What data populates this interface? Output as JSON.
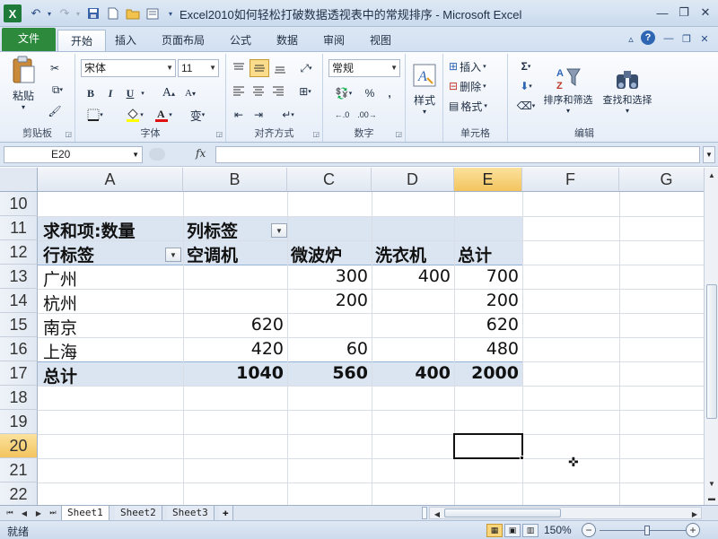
{
  "window": {
    "title": "Excel2010如何轻松打破数据透视表中的常规排序 - Microsoft Excel",
    "app_icon": "X"
  },
  "ribbon_tabs": [
    "文件",
    "开始",
    "插入",
    "页面布局",
    "公式",
    "数据",
    "审阅",
    "视图"
  ],
  "ribbon": {
    "clipboard": {
      "label": "剪贴板",
      "paste": "粘贴"
    },
    "font": {
      "label": "字体",
      "font_name": "宋体",
      "font_size": "11",
      "bold": "B",
      "italic": "I",
      "underline": "U",
      "grow": "A",
      "shrink": "A",
      "phonetic": "变"
    },
    "alignment": {
      "label": "对齐方式"
    },
    "number": {
      "label": "数字",
      "format": "常规",
      "percent": "%",
      "comma": ","
    },
    "styles": {
      "label": "样式"
    },
    "cells": {
      "label": "单元格",
      "insert": "插入",
      "delete": "删除",
      "format": "格式"
    },
    "editing": {
      "label": "编辑",
      "sum": "Σ",
      "sort_filter": "排序和筛选",
      "find_select": "查找和选择"
    }
  },
  "formula_bar": {
    "name_box": "E20",
    "fx": "fx",
    "formula": ""
  },
  "columns": [
    "A",
    "B",
    "C",
    "D",
    "E",
    "F",
    "G"
  ],
  "selected_column": "E",
  "rows": [
    "10",
    "11",
    "12",
    "13",
    "14",
    "15",
    "16",
    "17",
    "18",
    "19",
    "20",
    "21",
    "22"
  ],
  "selected_row": "20",
  "pivot": {
    "value_label": "求和项:数量",
    "col_label": "列标签",
    "row_label": "行标签",
    "headers": [
      "空调机",
      "微波炉",
      "洗衣机",
      "总计"
    ],
    "data_rows": [
      {
        "city": "广州",
        "values": [
          "",
          "300",
          "400",
          "700"
        ]
      },
      {
        "city": "杭州",
        "values": [
          "",
          "200",
          "",
          "200"
        ]
      },
      {
        "city": "南京",
        "values": [
          "620",
          "",
          "",
          "620"
        ]
      },
      {
        "city": "上海",
        "values": [
          "420",
          "60",
          "",
          "480"
        ]
      }
    ],
    "total_label": "总计",
    "totals": [
      "1040",
      "560",
      "400",
      "2000"
    ]
  },
  "sheets": [
    "Sheet1",
    "Sheet2",
    "Sheet3"
  ],
  "active_sheet": "Sheet1",
  "status": {
    "ready": "就绪",
    "zoom": "150%"
  }
}
